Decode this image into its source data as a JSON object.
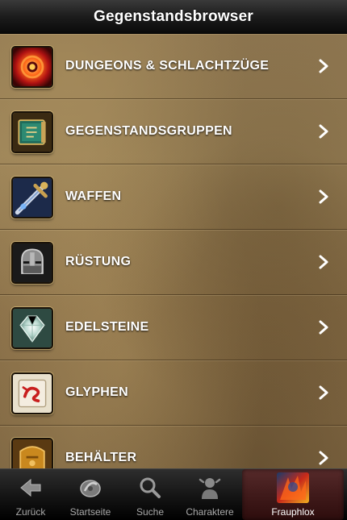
{
  "navbar": {
    "title": "Gegenstandsbrowser"
  },
  "items": [
    {
      "label": "DUNGEONS & SCHLACHTZÜGE",
      "icon": "dungeon-portal-icon"
    },
    {
      "label": "GEGENSTANDSGRUPPEN",
      "icon": "item-group-book-icon"
    },
    {
      "label": "WAFFEN",
      "icon": "weapon-sword-icon"
    },
    {
      "label": "RÜSTUNG",
      "icon": "armor-helmet-icon"
    },
    {
      "label": "EDELSTEINE",
      "icon": "gem-icon"
    },
    {
      "label": "GLYPHEN",
      "icon": "glyph-scroll-icon"
    },
    {
      "label": "BEHÄLTER",
      "icon": "container-bag-icon"
    }
  ],
  "tabbar": {
    "tabs": [
      {
        "label": "Zurück",
        "icon": "back-arrow-icon",
        "active": false
      },
      {
        "label": "Startseite",
        "icon": "home-emblem-icon",
        "active": false
      },
      {
        "label": "Suche",
        "icon": "search-icon",
        "active": false
      },
      {
        "label": "Charaktere",
        "icon": "character-icon",
        "active": false
      },
      {
        "label": "Frauphlox",
        "icon": "character-portrait-icon",
        "active": true
      }
    ]
  },
  "colors": {
    "navbar": "#1c1c1c",
    "parchment": "#8d7550",
    "text": "#ffffff",
    "tab_inactive_text": "#a8a8a8",
    "tab_active_bg": "#5a1c1c"
  }
}
